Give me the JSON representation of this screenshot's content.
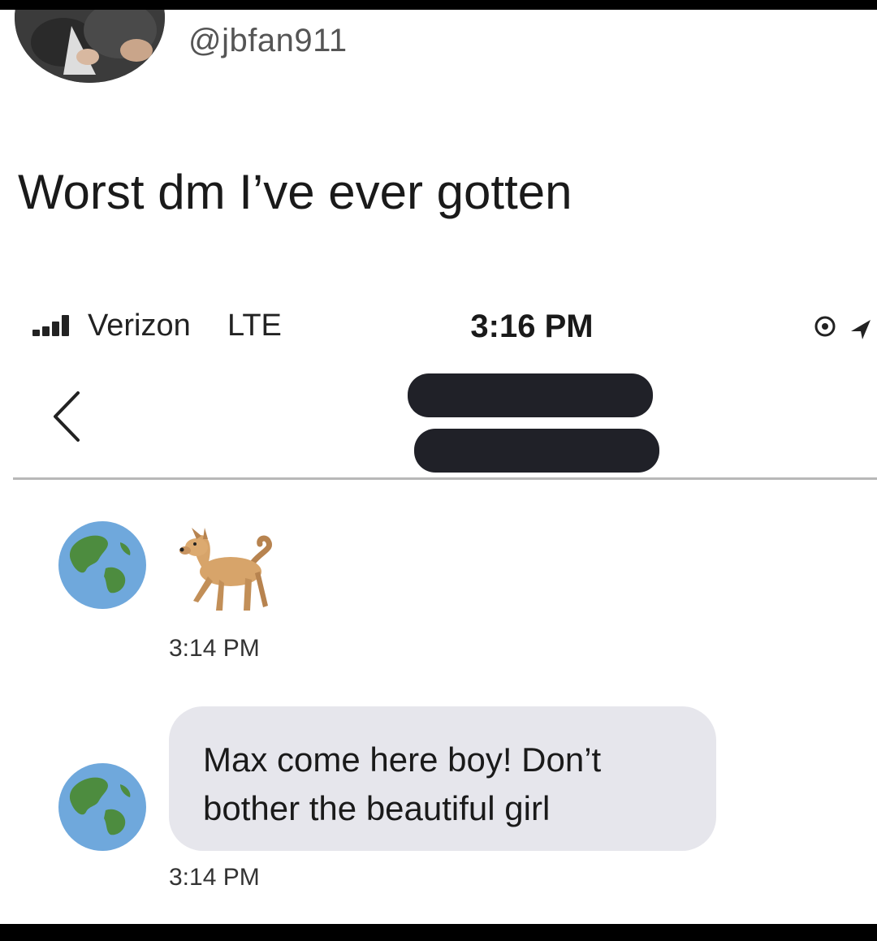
{
  "tweet": {
    "handle": "@jbfan911",
    "text": "Worst dm I’ve ever gotten"
  },
  "screenshot": {
    "status_bar": {
      "carrier": "Verizon",
      "network": "LTE",
      "time": "3:16 PM"
    },
    "header": {
      "back_icon": "chevron-left-icon",
      "contact_name_redacted": true
    },
    "messages": [
      {
        "sender_avatar": "earth-globe-icon",
        "content_type": "emoji",
        "emoji": "dog-emoji",
        "time": "3:14 PM"
      },
      {
        "sender_avatar": "earth-globe-icon",
        "content_type": "text",
        "text": "Max come here boy! Don’t bother the beautiful girl",
        "time": "3:14 PM"
      }
    ]
  },
  "colors": {
    "bubble_bg": "#e6e6ec",
    "redaction": "#202128",
    "frame": "#000000"
  }
}
